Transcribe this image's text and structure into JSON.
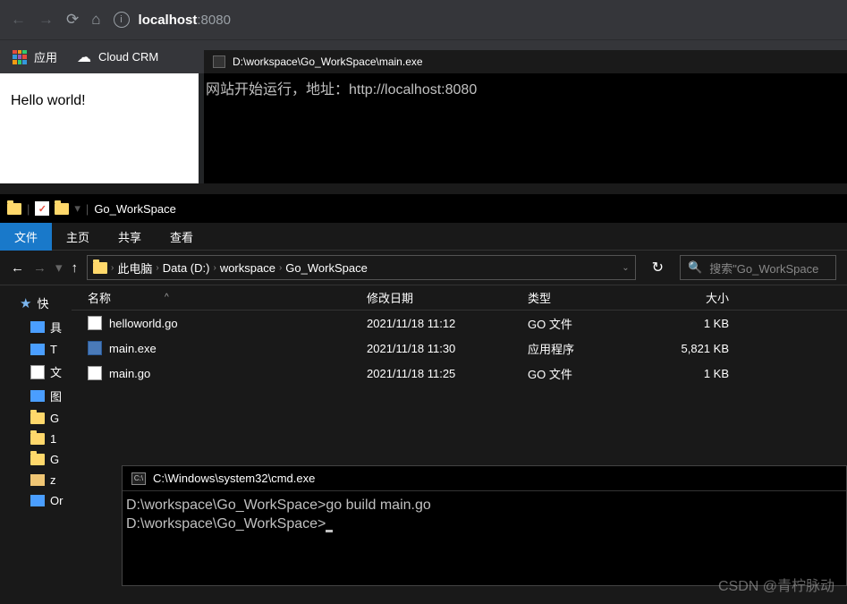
{
  "browser": {
    "url_host": "localhost",
    "url_port": ":8080",
    "bookmarks": {
      "apps": "应用",
      "cloud_crm": "Cloud CRM"
    },
    "page_text": "Hello world!"
  },
  "console1": {
    "title": "D:\\workspace\\Go_WorkSpace\\main.exe",
    "output": "网站开始运行，地址：http://localhost:8080"
  },
  "explorer": {
    "title": "Go_WorkSpace",
    "ribbon": {
      "file": "文件",
      "home": "主页",
      "share": "共享",
      "view": "查看"
    },
    "breadcrumb": [
      "此电脑",
      "Data (D:)",
      "workspace",
      "Go_WorkSpace"
    ],
    "search_placeholder": "搜索\"Go_WorkSpace",
    "columns": {
      "name": "名称",
      "date": "修改日期",
      "type": "类型",
      "size": "大小"
    },
    "sidebar_quick": "快",
    "sidebar_items": [
      "具",
      "T",
      "文",
      "图",
      "G",
      "1",
      "G",
      "z",
      "Or"
    ],
    "files": [
      {
        "name": "helloworld.go",
        "date": "2021/11/18 11:12",
        "type": "GO 文件",
        "size": "1 KB",
        "icon": "go"
      },
      {
        "name": "main.exe",
        "date": "2021/11/18 11:30",
        "type": "应用程序",
        "size": "5,821 KB",
        "icon": "exe"
      },
      {
        "name": "main.go",
        "date": "2021/11/18 11:25",
        "type": "GO 文件",
        "size": "1 KB",
        "icon": "go"
      }
    ]
  },
  "console2": {
    "title": "C:\\Windows\\system32\\cmd.exe",
    "lines": [
      "D:\\workspace\\Go_WorkSpace>go build main.go",
      "",
      "D:\\workspace\\Go_WorkSpace>"
    ]
  },
  "watermark": "CSDN @青柠脉动"
}
